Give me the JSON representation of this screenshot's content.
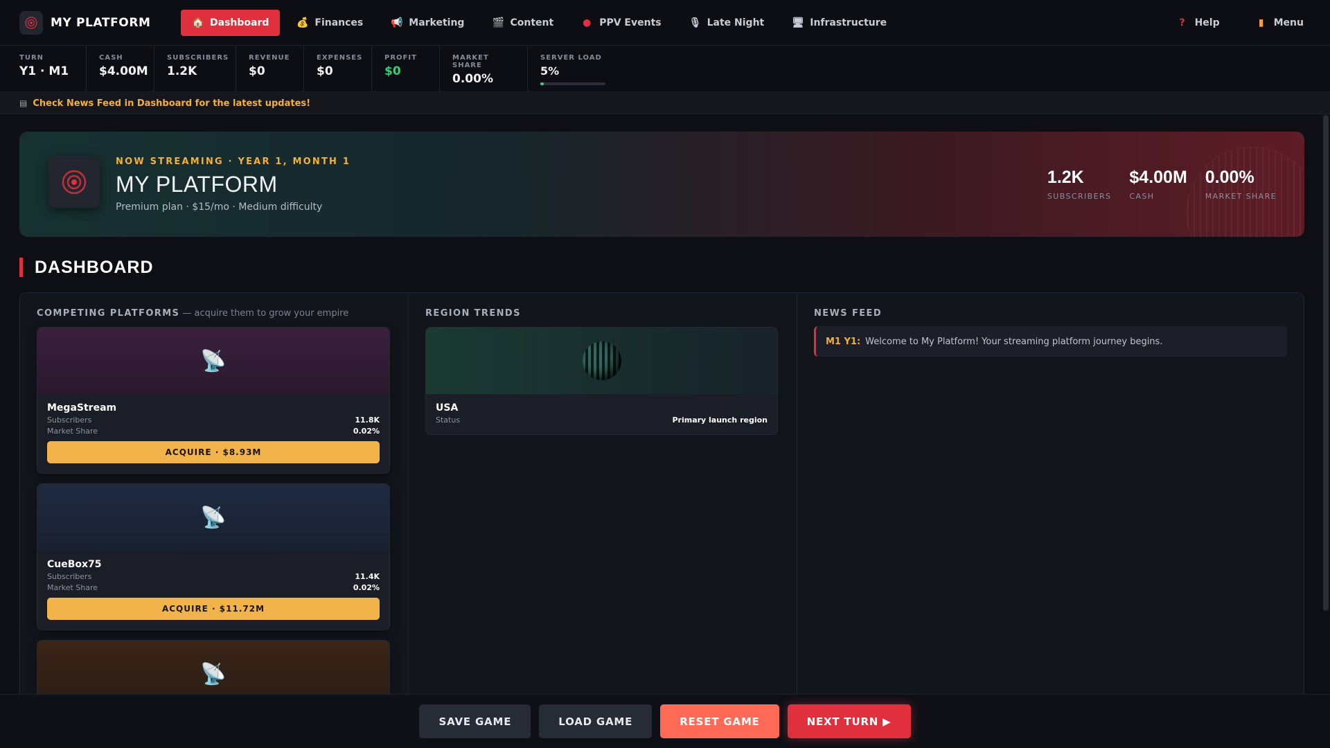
{
  "brand": {
    "name": "MY PLATFORM",
    "logo_icon": "target-icon"
  },
  "nav": {
    "items": [
      {
        "label": "Dashboard",
        "icon": "house-icon",
        "active": true
      },
      {
        "label": "Finances",
        "icon": "money-bag-icon"
      },
      {
        "label": "Marketing",
        "icon": "megaphone-icon"
      },
      {
        "label": "Content",
        "icon": "clapperboard-icon"
      },
      {
        "label": "PPV Events",
        "icon": "boxing-glove-icon"
      },
      {
        "label": "Late Night",
        "icon": "microphone-icon"
      },
      {
        "label": "Infrastructure",
        "icon": "monitor-icon"
      }
    ],
    "help": "Help",
    "menu": "Menu"
  },
  "stats": [
    {
      "label": "TURN",
      "value": "Y1 · M1"
    },
    {
      "label": "CASH",
      "value": "$4.00M"
    },
    {
      "label": "SUBSCRIBERS",
      "value": "1.2K"
    },
    {
      "label": "REVENUE",
      "value": "$0"
    },
    {
      "label": "EXPENSES",
      "value": "$0"
    },
    {
      "label": "PROFIT",
      "value": "$0"
    },
    {
      "label": "MARKET SHARE",
      "value": "0.00%"
    },
    {
      "label": "SERVER LOAD",
      "value": "5%",
      "level": 0.05
    }
  ],
  "ticker": "Check News Feed in Dashboard for the latest updates!",
  "hero": {
    "kicker": "NOW STREAMING · YEAR 1, MONTH 1",
    "title": "MY PLATFORM",
    "subtitle": "Premium plan · $15/mo · Medium difficulty",
    "stats": [
      {
        "value": "1.2K",
        "label": "SUBSCRIBERS"
      },
      {
        "value": "$4.00M",
        "label": "CASH"
      },
      {
        "value": "0.00%",
        "label": "MARKET SHARE"
      }
    ]
  },
  "section_title": "DASHBOARD",
  "competing": {
    "title": "COMPETING PLATFORMS",
    "hint": " — acquire them to grow your empire",
    "subscribers_label": "Subscribers",
    "share_label": "Market Share",
    "platforms": [
      {
        "name": "MegaStream",
        "subscribers": "11.8K",
        "share": "0.02%",
        "acquire": "ACQUIRE · $8.93M",
        "color": "#3a1f3d"
      },
      {
        "name": "CueBox75",
        "subscribers": "11.4K",
        "share": "0.02%",
        "acquire": "ACQUIRE · $11.72M",
        "color": "#1f2a40"
      },
      {
        "color": "#3a2518"
      }
    ]
  },
  "regions": {
    "title": "REGION TRENDS",
    "items": [
      {
        "name": "USA",
        "status_label": "Status",
        "status": "Primary launch region"
      }
    ]
  },
  "news": {
    "title": "NEWS FEED",
    "items": [
      {
        "when": "M1 Y1:",
        "text": "Welcome to My Platform! Your streaming platform journey begins."
      }
    ]
  },
  "footer": {
    "save": "SAVE GAME",
    "load": "LOAD GAME",
    "reset": "RESET GAME",
    "next": "NEXT TURN ▶"
  }
}
